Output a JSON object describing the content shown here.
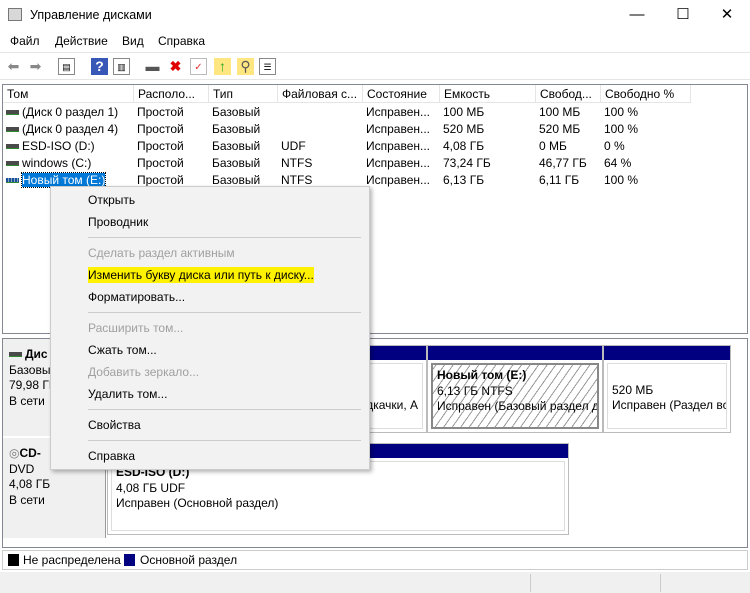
{
  "window": {
    "title": "Управление дисками",
    "minimize": "—",
    "maximize": "☐",
    "close": "✕"
  },
  "menubar": [
    "Файл",
    "Действие",
    "Вид",
    "Справка"
  ],
  "toolbar": [
    "back-icon",
    "forward-icon",
    "console-tree-icon",
    "help-icon",
    "action-pane-icon",
    "connect-disk-icon",
    "delete-icon",
    "properties-icon",
    "up-icon",
    "search-icon",
    "list-icon"
  ],
  "columns": [
    "Том",
    "Располо...",
    "Тип",
    "Файловая с...",
    "Состояние",
    "Емкость",
    "Свобод...",
    "Свободно %"
  ],
  "volumes": [
    {
      "name": "(Диск 0 раздел 1)",
      "layout": "Простой",
      "type": "Базовый",
      "fs": "",
      "status": "Исправен...",
      "capacity": "100 МБ",
      "free": "100 МБ",
      "free_pct": "100 %"
    },
    {
      "name": "(Диск 0 раздел 4)",
      "layout": "Простой",
      "type": "Базовый",
      "fs": "",
      "status": "Исправен...",
      "capacity": "520 МБ",
      "free": "520 МБ",
      "free_pct": "100 %"
    },
    {
      "name": "ESD-ISO (D:)",
      "layout": "Простой",
      "type": "Базовый",
      "fs": "UDF",
      "status": "Исправен...",
      "capacity": "4,08 ГБ",
      "free": "0 МБ",
      "free_pct": "0 %"
    },
    {
      "name": "windows (C:)",
      "layout": "Простой",
      "type": "Базовый",
      "fs": "NTFS",
      "status": "Исправен...",
      "capacity": "73,24 ГБ",
      "free": "46,77 ГБ",
      "free_pct": "64 %"
    },
    {
      "name": "Новый том (E:)",
      "layout": "Простой",
      "type": "Базовый",
      "fs": "NTFS",
      "status": "Исправен...",
      "capacity": "6,13 ГБ",
      "free": "6,11 ГБ",
      "free_pct": "100 %"
    }
  ],
  "disk0": {
    "name": "Дис",
    "type": "Базовы",
    "size": "79,98 ГБ",
    "state": "В сети",
    "partitions": [
      {
        "l3": "дкачки, А"
      },
      {
        "l1": "Новый том  (E:)",
        "l2": "6,13 ГБ NTFS",
        "l3": "Исправен (Базовый раздел ди"
      },
      {
        "l2": "520 МБ",
        "l3": "Исправен (Раздел вс"
      }
    ]
  },
  "cd0": {
    "name": "CD-",
    "type": "DVD",
    "size": "4,08 ГБ",
    "state": "В сети",
    "partition": {
      "l1": "ESD-ISO  (D:)",
      "l2": "4,08 ГБ UDF",
      "l3": "Исправен (Основной раздел)"
    }
  },
  "legend": [
    {
      "label": "Не распределена",
      "color": "#000000"
    },
    {
      "label": "Основной раздел",
      "color": "#000080"
    }
  ],
  "context_menu": [
    {
      "label": "Открыть",
      "enabled": true
    },
    {
      "label": "Проводник",
      "enabled": true
    },
    {
      "label": "Сделать раздел активным",
      "enabled": false
    },
    {
      "label": "Изменить букву диска или путь к диску...",
      "enabled": true,
      "highlighted": true
    },
    {
      "label": "Форматировать...",
      "enabled": true
    },
    {
      "label": "Расширить том...",
      "enabled": false
    },
    {
      "label": "Сжать том...",
      "enabled": true
    },
    {
      "label": "Добавить зеркало...",
      "enabled": false
    },
    {
      "label": "Удалить том...",
      "enabled": true
    },
    {
      "label": "Свойства",
      "enabled": true
    },
    {
      "label": "Справка",
      "enabled": true
    }
  ],
  "colors": {
    "selection": "#0078d7",
    "partition_header": "#000080",
    "highlight": "#fff200"
  }
}
